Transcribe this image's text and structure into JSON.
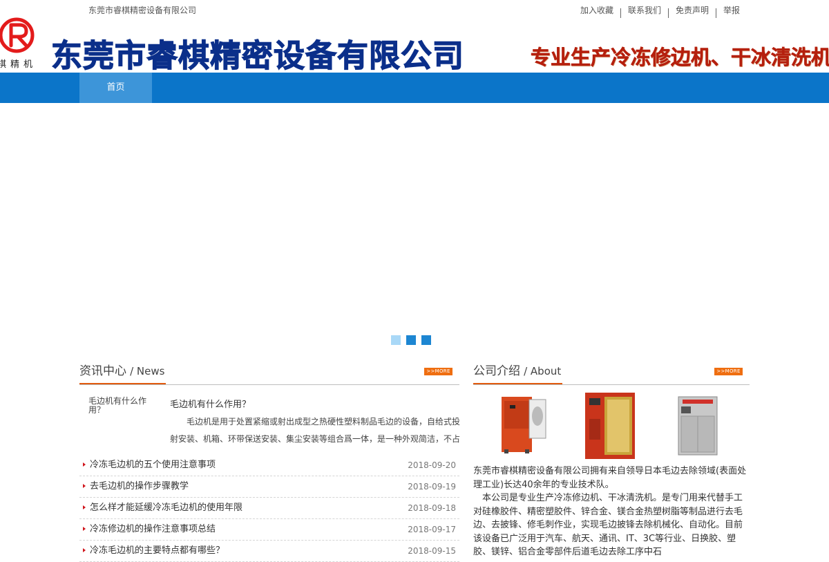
{
  "topbar": {
    "company_name": "东莞市睿棋精密设备有限公司",
    "links": [
      "加入收藏",
      "联系我们",
      "免责声明",
      "举报"
    ]
  },
  "header": {
    "logo_text": "棋精机",
    "title": "东莞市睿棋精密设备有限公司",
    "slogan": "专业生产冷冻修边机、干冰清洗机"
  },
  "nav": {
    "items": [
      "首页"
    ]
  },
  "banner": {
    "slide_count": 3,
    "active_index": 0
  },
  "colors": {
    "nav_blue": "#0b75c9",
    "accent_orange": "#ef6e10",
    "title_blue": "#0b2f8a",
    "slogan_red": "#b5200e"
  },
  "news": {
    "title_cn": "资讯中心",
    "title_en": "/ News",
    "more_label": ">>MORE",
    "feature": {
      "thumb_alt": "毛边机有什么作用？",
      "headline": "毛边机有什么作用？",
      "summary": "毛边机是用于处置紧缩或射出成型之热硬性塑料制品毛边的设备，自给式投射安装、机箱、环带保送安装、集尘安装等组合爲一体，是一种外观简洁，不占"
    },
    "items": [
      {
        "title": "冷冻毛边机的五个使用注意事项",
        "date": "2018-09-20"
      },
      {
        "title": "去毛边机的操作步骤教学",
        "date": "2018-09-19"
      },
      {
        "title": "怎么样才能延缓冷冻毛边机的使用年限",
        "date": "2018-09-18"
      },
      {
        "title": "冷冻修边机的操作注意事项总结",
        "date": "2018-09-17"
      },
      {
        "title": "冷冻毛边机的主要特点都有哪些？",
        "date": "2018-09-15"
      }
    ]
  },
  "about": {
    "title_cn": "公司介绍",
    "title_en": "/ About",
    "more_label": ">>MORE",
    "paragraph1": "东莞市睿棋精密设备有限公司拥有来自领导日本毛边去除领域(表面处理工业)长达40余年的专业技术队。",
    "paragraph2": "本公司是专业生产冷冻修边机、干冰清洗机。是专门用来代替手工对硅橡胶件、精密塑胶件、锌合金、镁合金热塑树脂等制品进行去毛边、去披锋、修毛刺作业，实现毛边披锋去除机械化、自动化。目前该设备已广泛用于汽车、航天、通讯、IT、3C等行业、日换胶、塑胶、镁锌、铝合金零部件后道毛边去除工序中石"
  }
}
